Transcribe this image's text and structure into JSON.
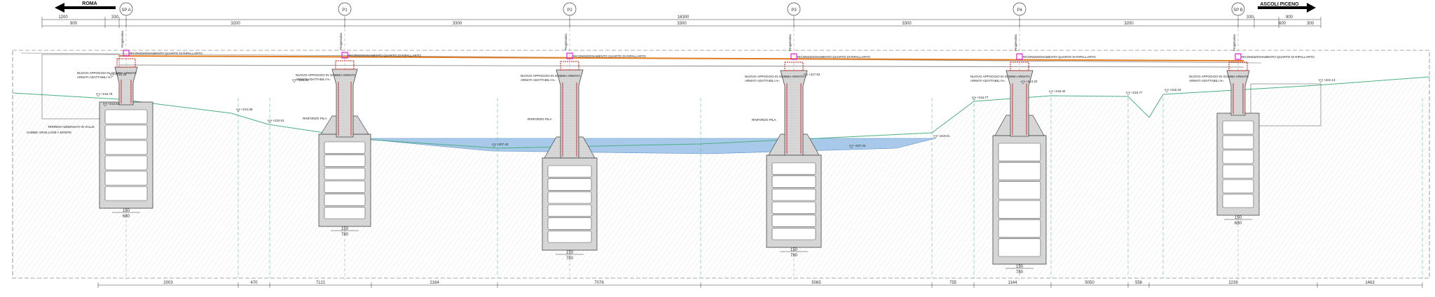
{
  "directions": {
    "left": "ROMA",
    "right": "ASCOLI PICENO"
  },
  "supports": [
    {
      "id": "SP A",
      "label": "SP A"
    },
    {
      "id": "P1",
      "label": "P1"
    },
    {
      "id": "P2",
      "label": "P2"
    },
    {
      "id": "P3",
      "label": "P3"
    },
    {
      "id": "P4",
      "label": "P4"
    },
    {
      "id": "SP B",
      "label": "SP B"
    }
  ],
  "top_dims": {
    "overall": "16300",
    "left_total": "1200",
    "left_sub": "900",
    "right_total": "900",
    "right_sub_1": "600",
    "right_sub_2": "300",
    "abut_a": "330",
    "abut_b": "330",
    "spans": [
      "3200",
      "3300",
      "3300",
      "3300",
      "3200"
    ]
  },
  "bottom_dims": [
    "2003",
    "470",
    "7121",
    "2164",
    "7076",
    "5065",
    "755",
    "1144",
    "5050",
    "556",
    "2239",
    "1463"
  ],
  "elevations": [
    "+216.79",
    "+214.61",
    "+212.08",
    "+210.91",
    "+207.43",
    "+207.34",
    "+210.01",
    "+216.77",
    "+218.40",
    "+216.77",
    "+218.43",
    "+222.13",
    "+212.39",
    "+216.86",
    "+217.52",
    "+213.20"
  ],
  "notes": {
    "adapt": "RICONDIZIONAMENTO QUARTO DI RIPALLARTO",
    "bearing": "NUOVO APPOGGIO IN GOMMA ARMATA",
    "bearing_sub": "ARMATI ADATTABILI H=",
    "pier_wrap": "RINFORZO PILA",
    "rock_top": "TERRENI ADDENSATI IN VALLE",
    "rock_bottom": "SABBIE ARGILLOSE A MONTE",
    "progressive_prefix": "Progressiva"
  },
  "pier_dims": {
    "cap_widths": [
      "150",
      "150",
      "150",
      "150",
      "150",
      "150"
    ],
    "base_widths": [
      "680",
      "780",
      "780",
      "780",
      "780",
      "680"
    ]
  },
  "colors": {
    "deck_line": "#e07b1f",
    "ground_line": "#4caf82",
    "water": "#a9c9ea",
    "rebar": "#d11a1a",
    "marker": "#e020e0",
    "concrete": "#e6e6e6",
    "soil": "#f4f4f4"
  }
}
